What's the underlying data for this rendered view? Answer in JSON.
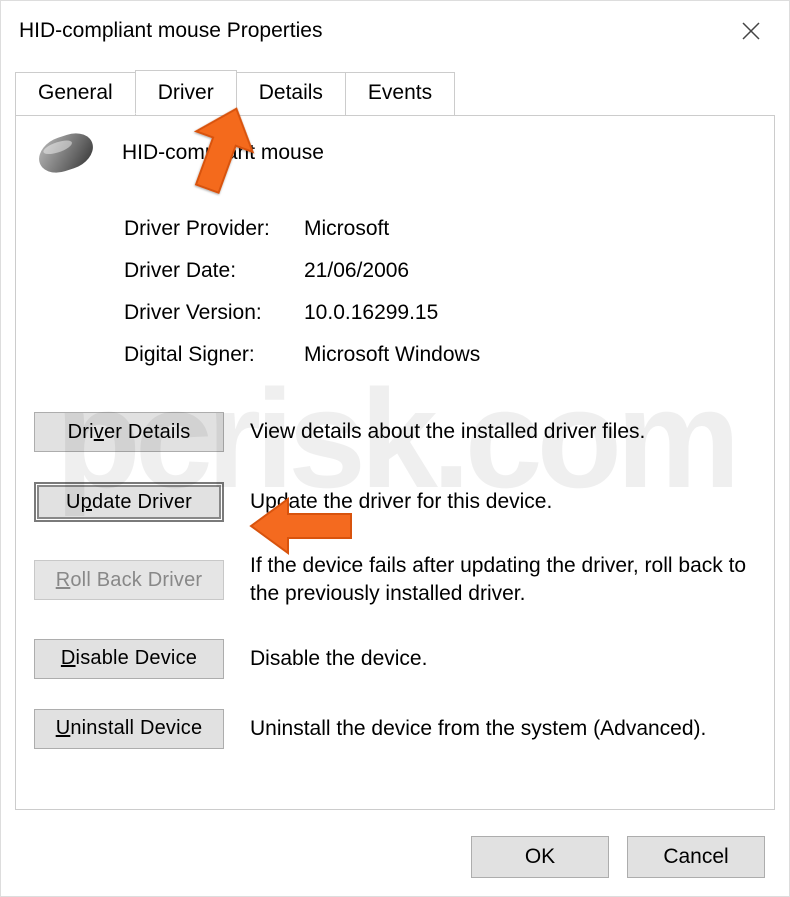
{
  "window_title": "HID-compliant mouse Properties",
  "tabs": [
    "General",
    "Driver",
    "Details",
    "Events"
  ],
  "active_tab_index": 1,
  "device_name": "HID-compliant mouse",
  "driver_info": [
    {
      "label": "Driver Provider:",
      "value": "Microsoft"
    },
    {
      "label": "Driver Date:",
      "value": "21/06/2006"
    },
    {
      "label": "Driver Version:",
      "value": "10.0.16299.15"
    },
    {
      "label": "Digital Signer:",
      "value": "Microsoft Windows"
    }
  ],
  "actions": {
    "details": {
      "label_pre": "Dri",
      "label_u": "v",
      "label_post": "er Details",
      "desc": "View details about the installed driver files."
    },
    "update": {
      "label_pre": "U",
      "label_u": "p",
      "label_post": "date Driver",
      "desc": "Update the driver for this device."
    },
    "rollback": {
      "label_pre": "",
      "label_u": "R",
      "label_post": "oll Back Driver",
      "desc": "If the device fails after updating the driver, roll back to the previously installed driver."
    },
    "disable": {
      "label_pre": "",
      "label_u": "D",
      "label_post": "isable Device",
      "desc": "Disable the device."
    },
    "uninstall": {
      "label_pre": "",
      "label_u": "U",
      "label_post": "ninstall Device",
      "desc": "Uninstall the device from the system (Advanced)."
    }
  },
  "dialog_buttons": {
    "ok": "OK",
    "cancel": "Cancel"
  },
  "watermark": "pcrisk.com",
  "annotations": {
    "arrow_tab": {
      "points_to": "tab-driver"
    },
    "arrow_update": {
      "points_to": "update-driver-button"
    }
  },
  "colors": {
    "arrow": "#f46a1f"
  }
}
